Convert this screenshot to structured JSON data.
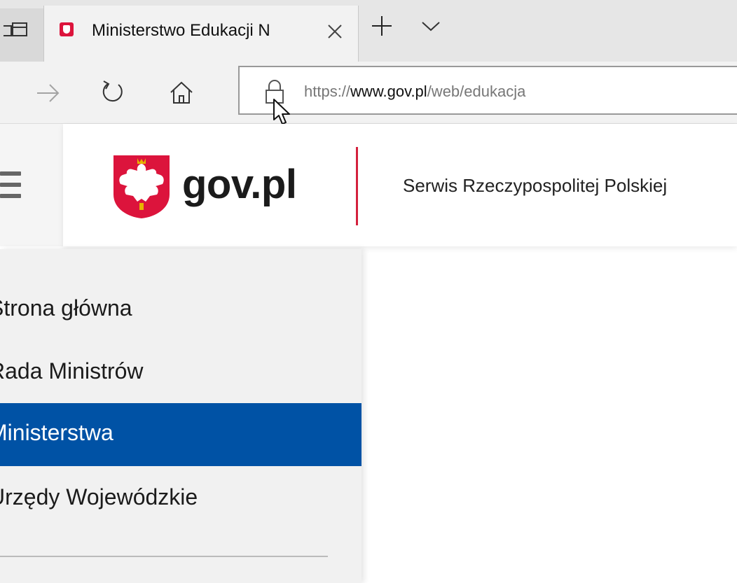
{
  "browser": {
    "tab_title": "Ministerstwo Edukacji N",
    "url_prefix": "https://",
    "url_host": "www.gov.pl",
    "url_path": "/web/edukacja",
    "icons": [
      "tab-preview-icon",
      "favicon-icon",
      "close-icon",
      "plus-icon",
      "chevron-down-icon",
      "forward-arrow-icon",
      "refresh-icon",
      "home-icon",
      "lock-icon",
      "cursor-icon"
    ]
  },
  "header": {
    "brand": "gov.pl",
    "tagline": "Serwis Rzeczypospolitej Polskiej",
    "accent_color": "#d4213d"
  },
  "sidebar": {
    "items": [
      {
        "label": "Strona główna",
        "active": false
      },
      {
        "label": "Rada Ministrów",
        "active": false
      },
      {
        "label": "Ministerstwa",
        "active": true
      },
      {
        "label": "Urzędy Wojewódzkie",
        "active": false
      }
    ],
    "active_color": "#0052a5"
  }
}
